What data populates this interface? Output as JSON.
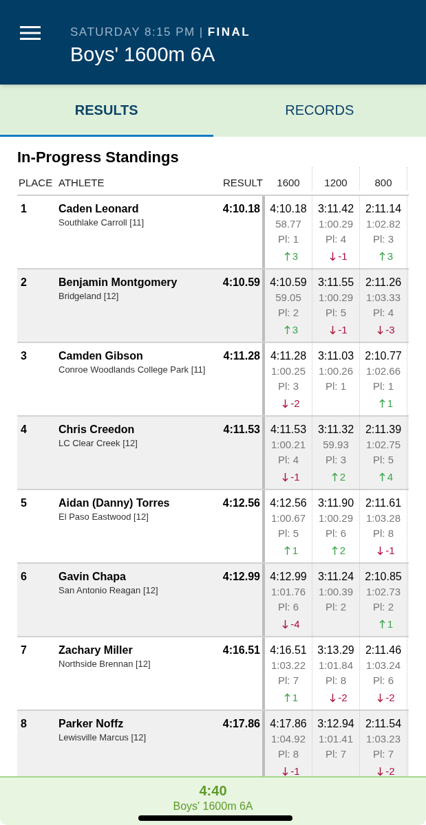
{
  "header": {
    "day_time": "SATURDAY 8:15 PM",
    "separator": "|",
    "status": "FINAL",
    "title": "Boys' 1600m 6A"
  },
  "tabs": [
    {
      "label": "RESULTS",
      "selected": true
    },
    {
      "label": "RECORDS",
      "selected": false
    }
  ],
  "section_title": "In-Progress Standings",
  "table": {
    "columns": [
      "PLACE",
      "ATHLETE",
      "RESULT",
      "1600",
      "1200",
      "800"
    ],
    "rows": [
      {
        "place": "1",
        "athlete": "Caden Leonard",
        "school": "Southlake Carroll [11]",
        "result": "4:10.18",
        "splits": [
          {
            "time": "4:10.18",
            "lap": "58.77",
            "place": "Pl: 1",
            "change": {
              "up": true,
              "text": "3"
            }
          },
          {
            "time": "3:11.42",
            "lap": "1:00.29",
            "place": "Pl: 4",
            "change": {
              "up": false,
              "text": "-1"
            }
          },
          {
            "time": "2:11.14",
            "lap": "1:02.82",
            "place": "Pl: 3",
            "change": {
              "up": true,
              "text": "3"
            }
          }
        ]
      },
      {
        "place": "2",
        "athlete": "Benjamin Montgomery",
        "school": "Bridgeland [12]",
        "result": "4:10.59",
        "splits": [
          {
            "time": "4:10.59",
            "lap": "59.05",
            "place": "Pl: 2",
            "change": {
              "up": true,
              "text": "3"
            }
          },
          {
            "time": "3:11.55",
            "lap": "1:00.29",
            "place": "Pl: 5",
            "change": {
              "up": false,
              "text": "-1"
            }
          },
          {
            "time": "2:11.26",
            "lap": "1:03.33",
            "place": "Pl: 4",
            "change": {
              "up": false,
              "text": "-3"
            }
          }
        ]
      },
      {
        "place": "3",
        "athlete": "Camden Gibson",
        "school": "Conroe Woodlands College Park [11]",
        "result": "4:11.28",
        "splits": [
          {
            "time": "4:11.28",
            "lap": "1:00.25",
            "place": "Pl: 3",
            "change": {
              "up": false,
              "text": "-2"
            }
          },
          {
            "time": "3:11.03",
            "lap": "1:00.26",
            "place": "Pl: 1"
          },
          {
            "time": "2:10.77",
            "lap": "1:02.66",
            "place": "Pl: 1",
            "change": {
              "up": true,
              "text": "1"
            }
          }
        ]
      },
      {
        "place": "4",
        "athlete": "Chris Creedon",
        "school": "LC Clear Creek [12]",
        "result": "4:11.53",
        "splits": [
          {
            "time": "4:11.53",
            "lap": "1:00.21",
            "place": "Pl: 4",
            "change": {
              "up": false,
              "text": "-1"
            }
          },
          {
            "time": "3:11.32",
            "lap": "59.93",
            "place": "Pl: 3",
            "change": {
              "up": true,
              "text": "2"
            }
          },
          {
            "time": "2:11.39",
            "lap": "1:02.75",
            "place": "Pl: 5",
            "change": {
              "up": true,
              "text": "4"
            }
          }
        ]
      },
      {
        "place": "5",
        "athlete": "Aidan (Danny) Torres",
        "school": "El Paso Eastwood [12]",
        "result": "4:12.56",
        "splits": [
          {
            "time": "4:12.56",
            "lap": "1:00.67",
            "place": "Pl: 5",
            "change": {
              "up": true,
              "text": "1"
            }
          },
          {
            "time": "3:11.90",
            "lap": "1:00.29",
            "place": "Pl: 6",
            "change": {
              "up": true,
              "text": "2"
            }
          },
          {
            "time": "2:11.61",
            "lap": "1:03.28",
            "place": "Pl: 8",
            "change": {
              "up": false,
              "text": "-1"
            }
          }
        ]
      },
      {
        "place": "6",
        "athlete": "Gavin Chapa",
        "school": "San Antonio Reagan [12]",
        "result": "4:12.99",
        "splits": [
          {
            "time": "4:12.99",
            "lap": "1:01.76",
            "place": "Pl: 6",
            "change": {
              "up": false,
              "text": "-4"
            }
          },
          {
            "time": "3:11.24",
            "lap": "1:00.39",
            "place": "Pl: 2"
          },
          {
            "time": "2:10.85",
            "lap": "1:02.73",
            "place": "Pl: 2",
            "change": {
              "up": true,
              "text": "1"
            }
          }
        ]
      },
      {
        "place": "7",
        "athlete": "Zachary Miller",
        "school": "Northside Brennan [12]",
        "result": "4:16.51",
        "splits": [
          {
            "time": "4:16.51",
            "lap": "1:03.22",
            "place": "Pl: 7",
            "change": {
              "up": true,
              "text": "1"
            }
          },
          {
            "time": "3:13.29",
            "lap": "1:01.84",
            "place": "Pl: 8",
            "change": {
              "up": false,
              "text": "-2"
            }
          },
          {
            "time": "2:11.46",
            "lap": "1:03.24",
            "place": "Pl: 6",
            "change": {
              "up": false,
              "text": "-2"
            }
          }
        ]
      },
      {
        "place": "8",
        "athlete": "Parker Noffz",
        "school": "Lewisville Marcus [12]",
        "result": "4:17.86",
        "splits": [
          {
            "time": "4:17.86",
            "lap": "1:04.92",
            "place": "Pl: 8",
            "change": {
              "up": false,
              "text": "-1"
            }
          },
          {
            "time": "3:12.94",
            "lap": "1:01.41",
            "place": "Pl: 7"
          },
          {
            "time": "2:11.54",
            "lap": "1:03.23",
            "place": "Pl: 7",
            "change": {
              "up": false,
              "text": "-2"
            }
          }
        ]
      }
    ]
  },
  "bottom_bar": {
    "time": "4:40",
    "event": "Boys' 1600m 6A"
  }
}
